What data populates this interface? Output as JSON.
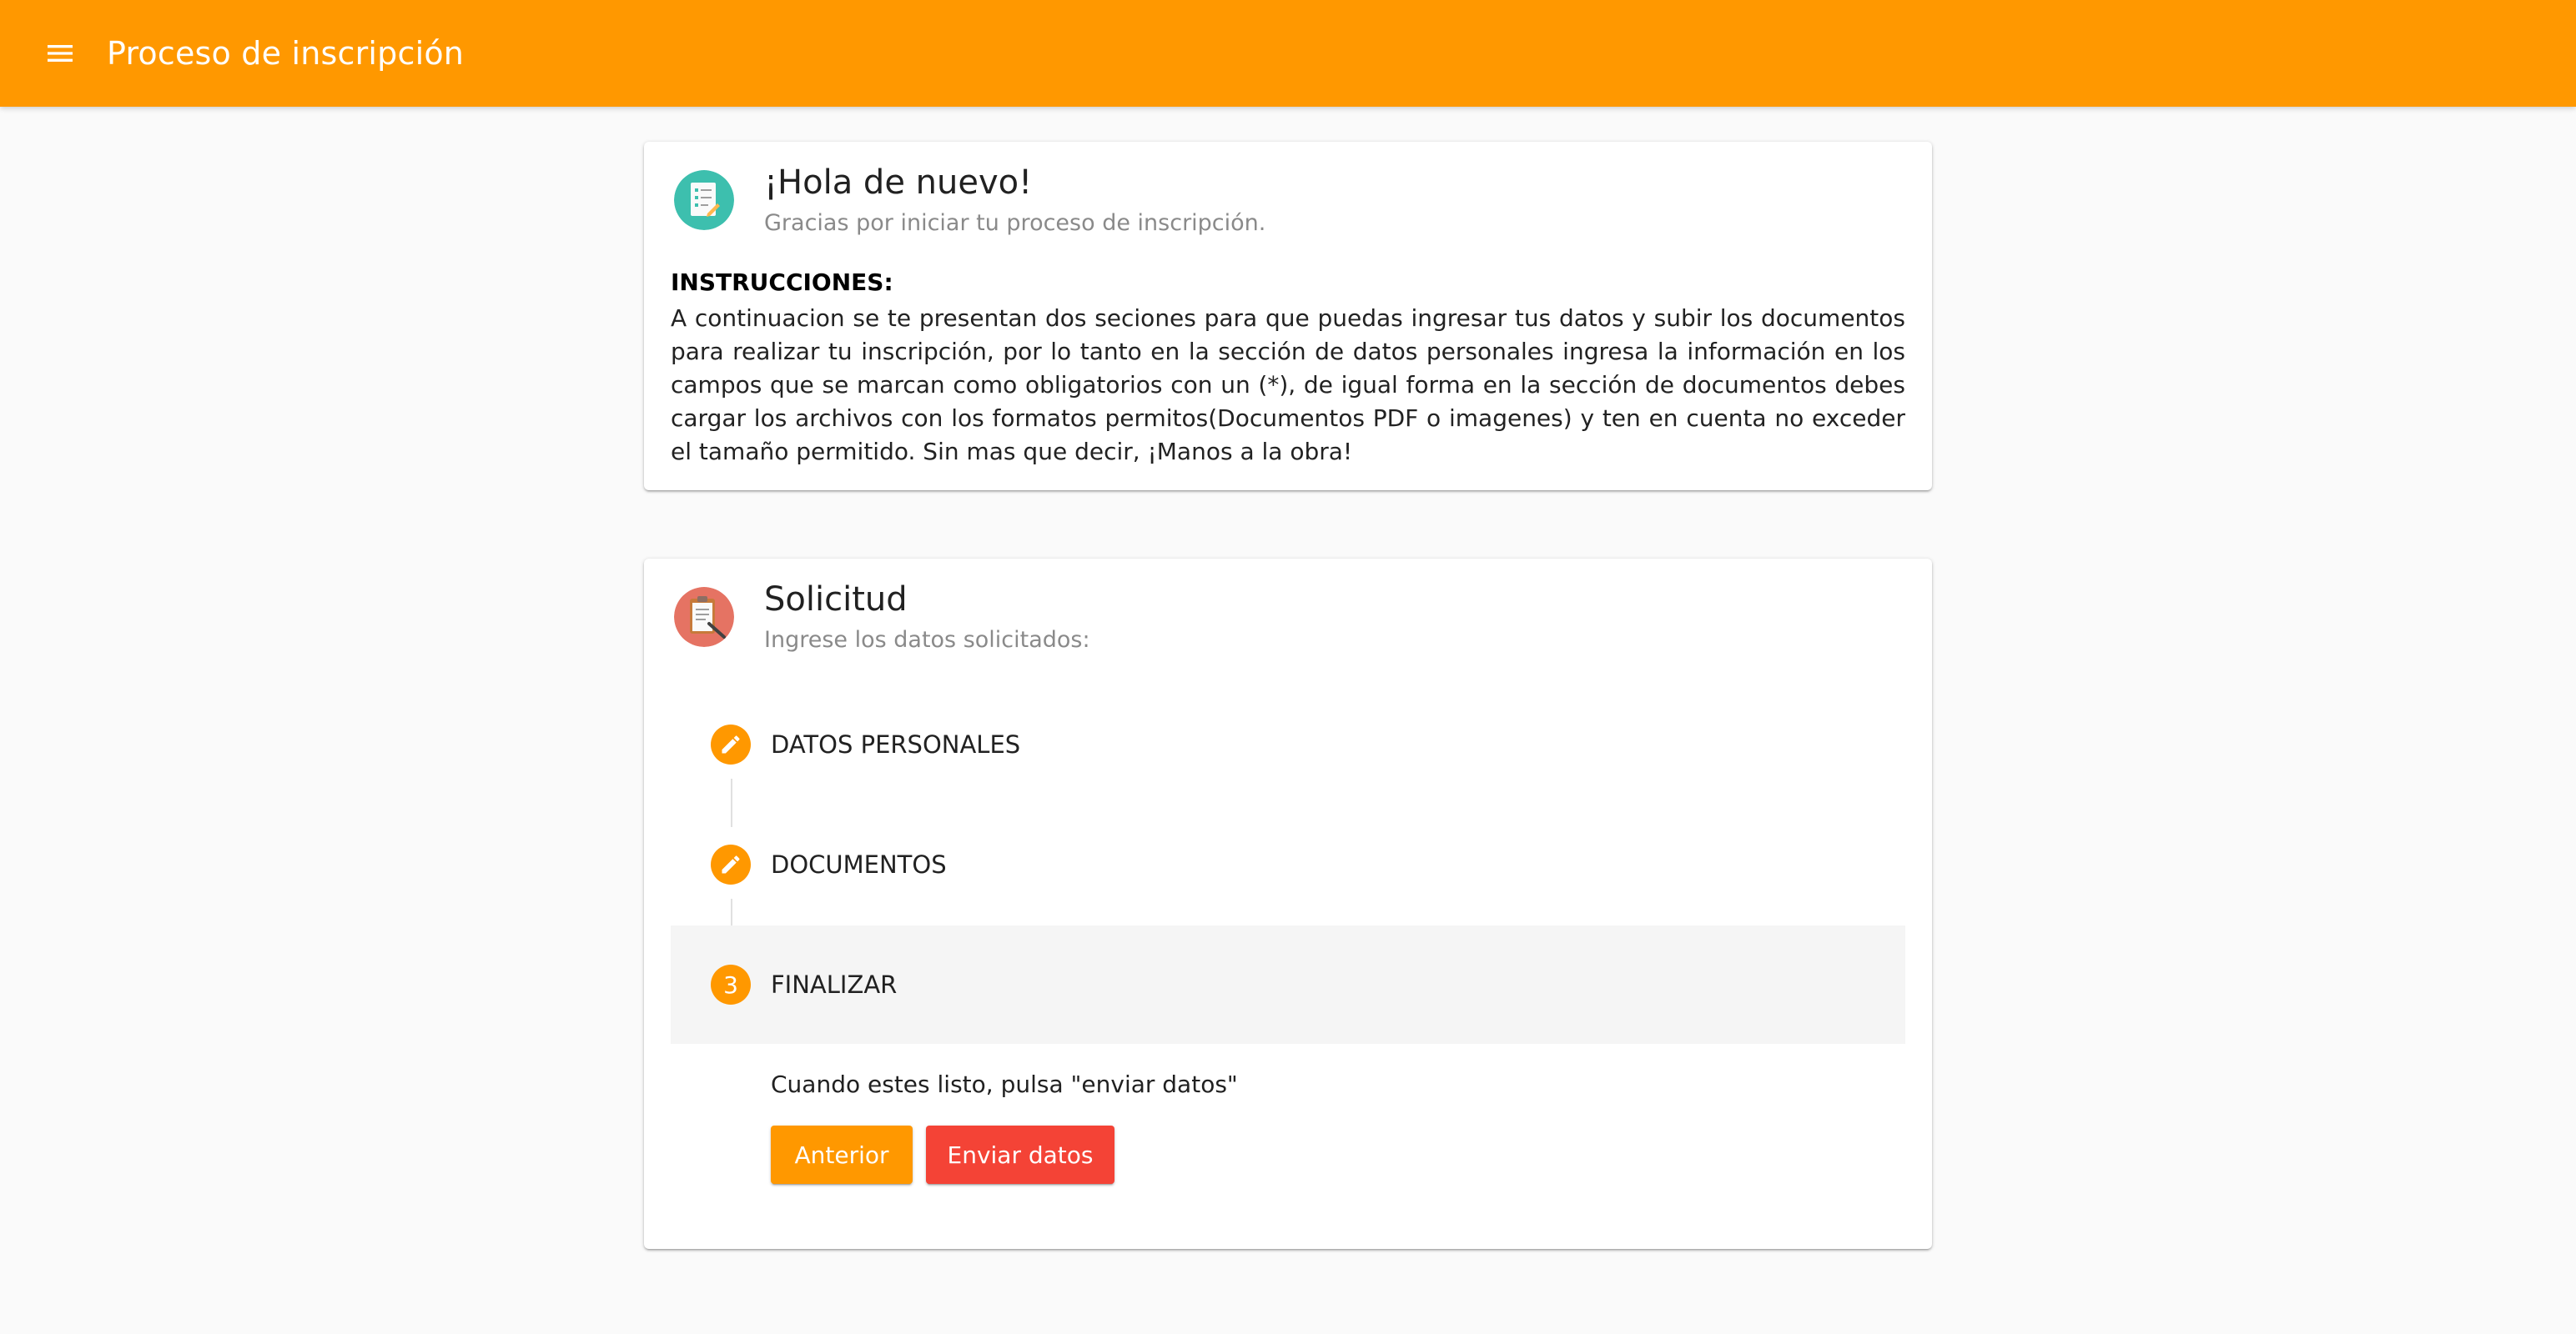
{
  "header": {
    "title": "Proceso de inscripción",
    "color": "#ff9800",
    "menu_icon": "menu-icon"
  },
  "welcome_card": {
    "avatar_icon": "checklist-icon",
    "title": "¡Hola de nuevo!",
    "subtitle": "Gracias por iniciar tu proceso de inscripción.",
    "instructions_label": "INSTRUCCIONES:",
    "instructions_text": "A continuacion se te presentan dos seciones para que puedas ingresar tus datos y subir los documentos para realizar tu inscripción, por lo tanto en la sección de datos personales ingresa la información en los campos que se marcan como obligatorios con un (*), de igual forma en la sección de documentos debes cargar los archivos con los formatos permitos(Documentos PDF o imagenes) y ten en cuenta no exceder el tamaño permitido. Sin mas que decir, ¡Manos a la obra!"
  },
  "request_card": {
    "avatar_icon": "clipboard-icon",
    "title": "Solicitud",
    "subtitle": "Ingrese los datos solicitados:",
    "steps": [
      {
        "label": "DATOS PERSONALES",
        "icon": "edit-icon",
        "state": "edit"
      },
      {
        "label": "DOCUMENTOS",
        "icon": "edit-icon",
        "state": "edit"
      },
      {
        "label": "FINALIZAR",
        "number": "3",
        "state": "active"
      }
    ],
    "final_step": {
      "message": "Cuando estes listo, pulsa \"enviar datos\"",
      "prev_button": "Anterior",
      "send_button": "Enviar datos"
    }
  },
  "colors": {
    "accent": "#ff9800",
    "warn": "#f44336"
  }
}
